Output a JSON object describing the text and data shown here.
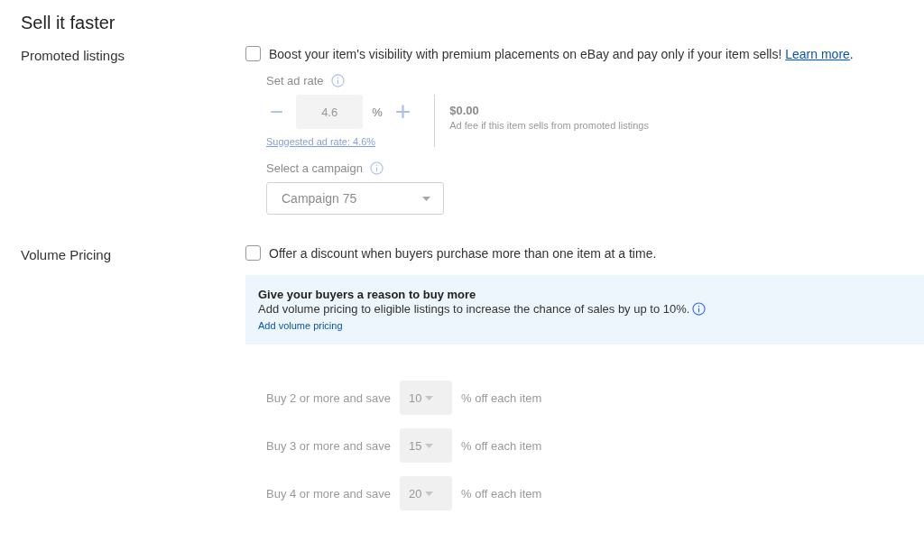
{
  "title": "Sell it faster",
  "promoted": {
    "label": "Promoted listings",
    "checked": false,
    "text": "Boost your item's visibility with premium placements on eBay and pay only if your item sells!",
    "link": "Learn more",
    "after": ".",
    "disabled": true,
    "ad_rate": {
      "label": "Set ad rate",
      "minus": "−",
      "value": "4.6",
      "unit": "%",
      "plus": "+",
      "suggested": "Suggested ad rate: 4.6%"
    },
    "fee": {
      "amount": "$0.00",
      "note": "Ad fee if this item sells from promoted listings"
    },
    "campaign": {
      "label": "Select a campaign",
      "value": "Campaign 75"
    }
  },
  "volume": {
    "label": "Volume Pricing",
    "checked": false,
    "text": "Offer a discount when buyers purchase more than one item at a time.",
    "banner": {
      "title": "Give your buyers a reason to buy more",
      "text": "Add volume pricing to eligible listings to increase the chance of sales by up to 10%.",
      "link": "Add volume pricing"
    },
    "disabled": true,
    "tiers": [
      {
        "label": "Buy 2 or more and save",
        "value": "10",
        "suffix": "% off each item"
      },
      {
        "label": "Buy 3 or more and save",
        "value": "15",
        "suffix": "% off each item"
      },
      {
        "label": "Buy 4 or more and save",
        "value": "20",
        "suffix": "% off each item"
      }
    ]
  }
}
